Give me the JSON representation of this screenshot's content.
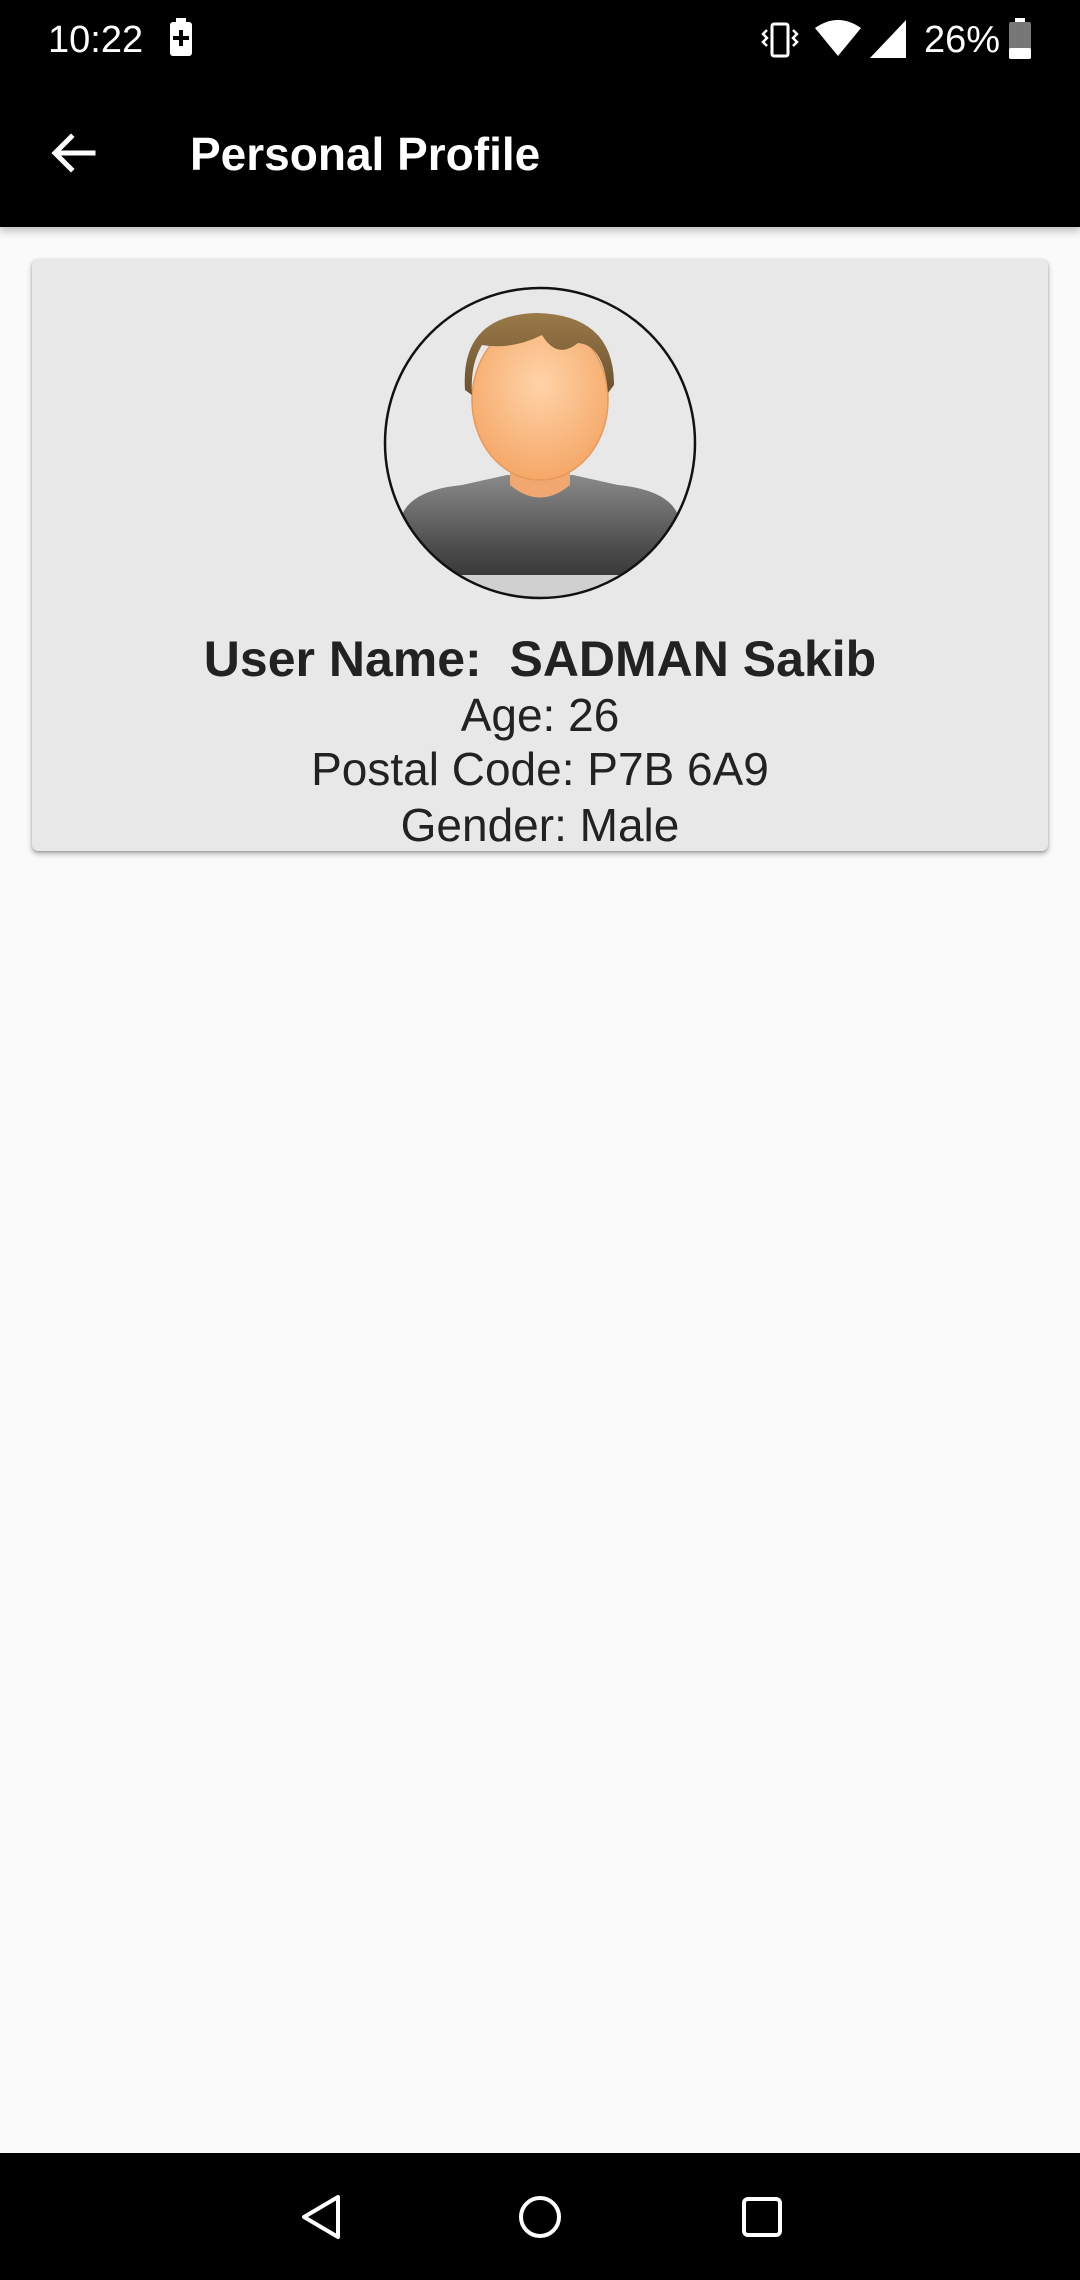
{
  "status_bar": {
    "time": "10:22",
    "battery_percent": "26%",
    "icons": [
      "battery-saver-icon",
      "vibrate-icon",
      "wifi-icon",
      "signal-icon",
      "battery-icon"
    ]
  },
  "app_bar": {
    "title": "Personal Profile",
    "back_icon": "arrow-left-icon"
  },
  "profile": {
    "avatar_icon": "default-user-avatar",
    "user_name_line": "User Name:  SADMAN Sakib",
    "age_line": "Age: 26",
    "postal_code_line": "Postal Code: P7B 6A9",
    "gender_line": "Gender: Male"
  },
  "nav_bar": {
    "icons": [
      "nav-back-icon",
      "nav-home-icon",
      "nav-recents-icon"
    ]
  },
  "colors": {
    "app_bar_bg": "#000000",
    "page_bg": "#fafafa",
    "card_bg": "#e8e8e8",
    "text": "#222222"
  }
}
